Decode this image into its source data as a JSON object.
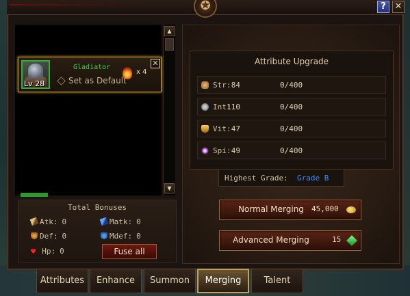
{
  "window": {
    "help_label": "?",
    "close_label": "✕",
    "emblem_icon": "crest-icon"
  },
  "list": {
    "scroll_up_icon": "▲",
    "scroll_down_icon": "▼"
  },
  "hero_card": {
    "level": "Lv 28",
    "class_name": "Gladiator",
    "set_default_label": "Set as Default",
    "material_count": "x 4",
    "close_label": "✕",
    "material_icon": "fire-crystal-icon"
  },
  "bonuses": {
    "title": "Total Bonuses",
    "atk_label": "Atk:",
    "atk_value": "0",
    "matk_label": "Matk:",
    "matk_value": "0",
    "def_label": "Def:",
    "def_value": "0",
    "mdef_label": "Mdef:",
    "mdef_value": "0",
    "hp_label": "Hp:",
    "hp_value": "0",
    "fuse_label": "Fuse all"
  },
  "attribute_upgrade": {
    "title": "Attribute Upgrade",
    "rows": [
      {
        "label": "Str:",
        "value": "84",
        "progress": "0/400",
        "icon": "fist-icon",
        "color": "#d8a060"
      },
      {
        "label": "Int:",
        "value": "110",
        "progress": "0/400",
        "icon": "brain-icon",
        "color": "#60a8e8"
      },
      {
        "label": "Vit:",
        "value": "47",
        "progress": "0/400",
        "icon": "trophy-icon",
        "color": "#e8b040"
      },
      {
        "label": "Spi:",
        "value": "49",
        "progress": "0/400",
        "icon": "spark-icon",
        "color": "#c060ff"
      }
    ]
  },
  "grade": {
    "label": "Highest Grade:",
    "value": "Grade B"
  },
  "merging": {
    "normal_label": "Normal Merging",
    "normal_cost": "45,000",
    "normal_cost_icon": "gold-coin-icon",
    "advanced_label": "Advanced Merging",
    "advanced_cost": "15",
    "advanced_cost_icon": "gem-icon"
  },
  "tabs": [
    {
      "label": "Attributes",
      "active": false
    },
    {
      "label": "Enhance",
      "active": false
    },
    {
      "label": "Summon",
      "active": false
    },
    {
      "label": "Merging",
      "active": true
    },
    {
      "label": "Talent",
      "active": false
    }
  ]
}
